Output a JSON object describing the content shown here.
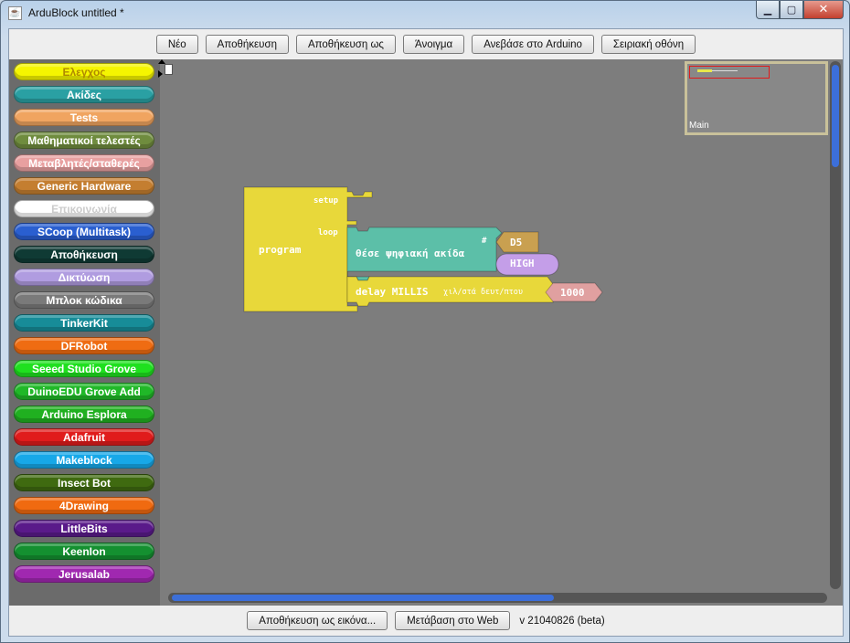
{
  "window": {
    "title": "ArduBlock untitled *",
    "app_icon": "java-icon"
  },
  "toolbar": {
    "new_label": "Νέο",
    "save_label": "Αποθήκευση",
    "save_as_label": "Αποθήκευση ως",
    "open_label": "Άνοιγμα",
    "upload_label": "Ανεβάσε στο Arduino",
    "serial_label": "Σειριακή οθόνη"
  },
  "palette": {
    "categories": [
      {
        "label": "Ελεγχος",
        "color": "#f5f500",
        "text_color": "#b08a00"
      },
      {
        "label": "Ακίδες",
        "color": "#2aa0a3",
        "text_color": "#ffffff"
      },
      {
        "label": "Tests",
        "color": "#f0a460",
        "text_color": "#ffffff"
      },
      {
        "label": "Μαθηματικοί τελεστές",
        "color": "#6f8c3e",
        "text_color": "#ffffff"
      },
      {
        "label": "Μεταβλητές/σταθερές",
        "color": "#e8a0a0",
        "text_color": "#ffffff"
      },
      {
        "label": "Generic Hardware",
        "color": "#c47e30",
        "text_color": "#ffffff"
      },
      {
        "label": "Επικοινωνία",
        "color": "#ffffff",
        "text_color": "#cccccc"
      },
      {
        "label": "SCoop (Multitask)",
        "color": "#2a5fd0",
        "text_color": "#ffffff"
      },
      {
        "label": "Αποθήκευση",
        "color": "#0f3a34",
        "text_color": "#ffffff"
      },
      {
        "label": "Δικτύωση",
        "color": "#b09ce0",
        "text_color": "#ffffff"
      },
      {
        "label": "Μπλοκ κώδικα",
        "color": "#7a7a7a",
        "text_color": "#ffffff"
      },
      {
        "label": "TinkerKit",
        "color": "#178c98",
        "text_color": "#ffffff"
      },
      {
        "label": "DFRobot",
        "color": "#ef6c12",
        "text_color": "#ffffff"
      },
      {
        "label": "Seeed Studio Grove",
        "color": "#1fe01f",
        "text_color": "#ffffff"
      },
      {
        "label": "DuinoEDU Grove Add",
        "color": "#20b828",
        "text_color": "#ffffff"
      },
      {
        "label": "Arduino Esplora",
        "color": "#20b020",
        "text_color": "#ffffff"
      },
      {
        "label": "Adafruit",
        "color": "#e01c1c",
        "text_color": "#ffffff"
      },
      {
        "label": "Makeblock",
        "color": "#17a8e8",
        "text_color": "#ffffff"
      },
      {
        "label": "Insect Bot",
        "color": "#3f6a10",
        "text_color": "#ffffff"
      },
      {
        "label": "4Drawing",
        "color": "#f06a10",
        "text_color": "#ffffff"
      },
      {
        "label": "LittleBits",
        "color": "#5a1a8a",
        "text_color": "#ffffff"
      },
      {
        "label": "KeenIon",
        "color": "#149030",
        "text_color": "#ffffff"
      },
      {
        "label": "Jerusalab",
        "color": "#a028b0",
        "text_color": "#ffffff"
      }
    ]
  },
  "canvas": {
    "background": "#7d7d7d",
    "minimap_label": "Main",
    "blocks": {
      "program": {
        "label": "program",
        "setup_label": "setup",
        "loop_label": "loop",
        "color": "#e8d83a"
      },
      "digital_write": {
        "label": "θέσε ψηφιακή ακίδα",
        "hash_label": "#",
        "color": "#5cbfa8"
      },
      "pin": {
        "label": "D5",
        "color": "#c9a050"
      },
      "level": {
        "label": "HIGH",
        "color": "#c49ee8"
      },
      "delay": {
        "label": "delay MILLIS",
        "unit_label": "χιλ/στά δευτ/πτου",
        "color": "#e8d83a"
      },
      "delay_value": {
        "label": "1000",
        "color": "#e0a0a0"
      }
    }
  },
  "bottombar": {
    "save_image_label": "Αποθήκευση ως εικόνα...",
    "web_label": "Μετάβαση στο Web",
    "version": "v 21040826 (beta)"
  }
}
